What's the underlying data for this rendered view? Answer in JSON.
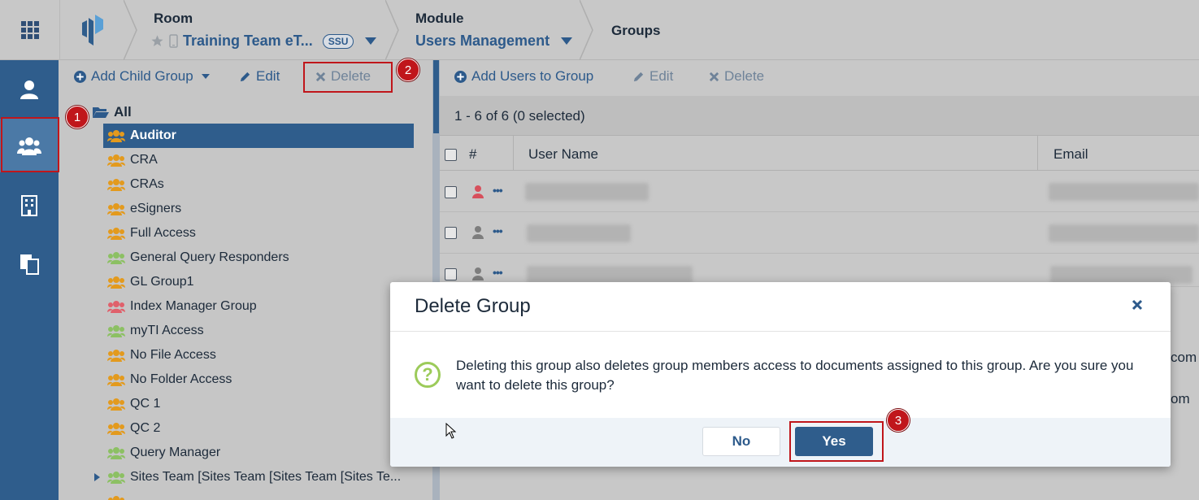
{
  "topbar": {
    "room_label": "Room",
    "room_value": "Training Team eT...",
    "room_badge": "SSU",
    "module_label": "Module",
    "module_value": "Users Management",
    "current_page": "Groups"
  },
  "tree_toolbar": {
    "add_child_group": "Add Child Group",
    "edit": "Edit",
    "delete": "Delete"
  },
  "tree": {
    "root": "All",
    "items": [
      {
        "label": "Auditor",
        "color": "#e39a1d",
        "selected": true
      },
      {
        "label": "CRA",
        "color": "#e39a1d",
        "selected": false
      },
      {
        "label": "CRAs",
        "color": "#e39a1d",
        "selected": false
      },
      {
        "label": "eSigners",
        "color": "#e39a1d",
        "selected": false
      },
      {
        "label": "Full Access",
        "color": "#e39a1d",
        "selected": false
      },
      {
        "label": "General Query Responders",
        "color": "#8cc063",
        "selected": false
      },
      {
        "label": "GL Group1",
        "color": "#e39a1d",
        "selected": false
      },
      {
        "label": "Index Manager Group",
        "color": "#e0606b",
        "selected": false
      },
      {
        "label": "myTI Access",
        "color": "#8cc063",
        "selected": false
      },
      {
        "label": "No File Access",
        "color": "#e39a1d",
        "selected": false
      },
      {
        "label": "No Folder Access",
        "color": "#e39a1d",
        "selected": false
      },
      {
        "label": "QC 1",
        "color": "#e39a1d",
        "selected": false
      },
      {
        "label": "QC 2",
        "color": "#e39a1d",
        "selected": false
      },
      {
        "label": "Query Manager",
        "color": "#8cc063",
        "selected": false
      },
      {
        "label": "Sites Team [Sites Team [Sites Team [Sites Te...",
        "color": "#8cc063",
        "selected": false
      }
    ]
  },
  "users_toolbar": {
    "add_users": "Add Users to Group",
    "edit": "Edit",
    "delete": "Delete"
  },
  "grid": {
    "count_text": "1 - 6 of 6 (0 selected)",
    "col_hash": "#",
    "col_username": "User Name",
    "col_email": "Email",
    "email_fragment_1": "com",
    "email_fragment_2": "om"
  },
  "dialog": {
    "title": "Delete Group",
    "message": "Deleting this group also deletes group members access to documents assigned to this group. Are you sure you want to delete this group?",
    "no_label": "No",
    "yes_label": "Yes"
  },
  "annotations": {
    "badge_1": "1",
    "badge_2": "2",
    "badge_3": "3"
  },
  "colors": {
    "accent": "#2f5d8c",
    "highlight": "#c0161b",
    "group_orange": "#e39a1d",
    "group_green": "#8cc063",
    "group_red": "#e0606b"
  }
}
